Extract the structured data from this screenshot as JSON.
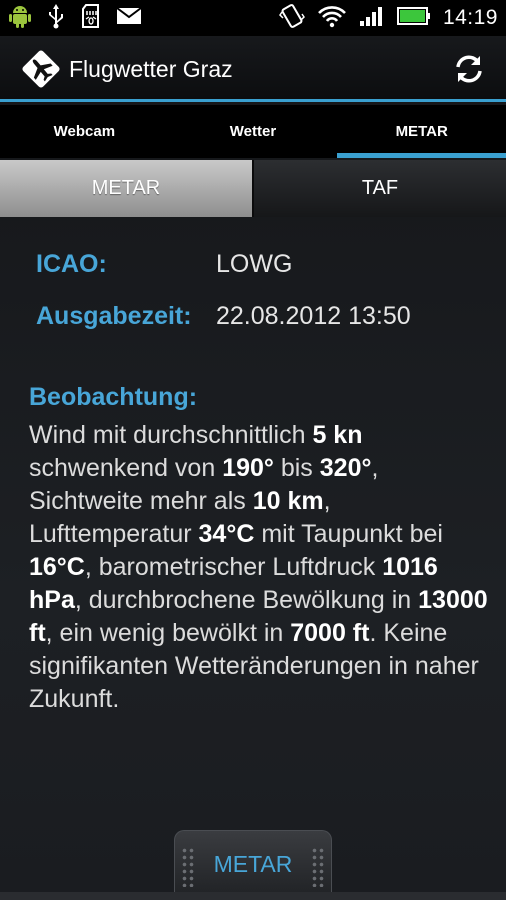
{
  "status_bar": {
    "time": "14:19",
    "icons": [
      "android-debug-icon",
      "usb-icon",
      "sd-card-icon",
      "mail-icon",
      "vibrate-icon",
      "wifi-icon",
      "signal-icon",
      "battery-icon"
    ]
  },
  "app_bar": {
    "title": "Flugwetter Graz",
    "logo_icon": "airplane-icon",
    "action_icon": "refresh-icon"
  },
  "tabs": [
    {
      "label": "Webcam",
      "active": false
    },
    {
      "label": "Wetter",
      "active": false
    },
    {
      "label": "METAR",
      "active": true
    }
  ],
  "segment": {
    "options": [
      "METAR",
      "TAF"
    ],
    "selected": "METAR"
  },
  "details": {
    "icao_label": "ICAO:",
    "icao_value": "LOWG",
    "time_label": "Ausgabezeit:",
    "time_value": "22.08.2012 13:50"
  },
  "observation": {
    "label": "Beobachtung:",
    "segments": [
      {
        "text": "Wind mit durchschnittlich ",
        "bold": false
      },
      {
        "text": "5 kn",
        "bold": true
      },
      {
        "text": " schwenkend von ",
        "bold": false
      },
      {
        "text": "190°",
        "bold": true
      },
      {
        "text": " bis ",
        "bold": false
      },
      {
        "text": "320°",
        "bold": true
      },
      {
        "text": ", Sichtweite mehr als ",
        "bold": false
      },
      {
        "text": "10 km",
        "bold": true
      },
      {
        "text": ", Lufttemperatur ",
        "bold": false
      },
      {
        "text": "34°C",
        "bold": true
      },
      {
        "text": " mit Taupunkt bei ",
        "bold": false
      },
      {
        "text": "16°C",
        "bold": true
      },
      {
        "text": ", barometrischer Luftdruck ",
        "bold": false
      },
      {
        "text": "1016 hPa",
        "bold": true
      },
      {
        "text": ", durchbrochene Bewölkung in ",
        "bold": false
      },
      {
        "text": "13000 ft",
        "bold": true
      },
      {
        "text": ", ein wenig bewölkt in ",
        "bold": false
      },
      {
        "text": "7000 ft",
        "bold": true
      },
      {
        "text": ". Keine signifikanten Wetteränderungen in naher Zukunft.",
        "bold": false
      }
    ]
  },
  "bottom_handle": {
    "label": "METAR"
  },
  "colors": {
    "accent": "#3aa0d0",
    "label_blue": "#48a6d8"
  }
}
